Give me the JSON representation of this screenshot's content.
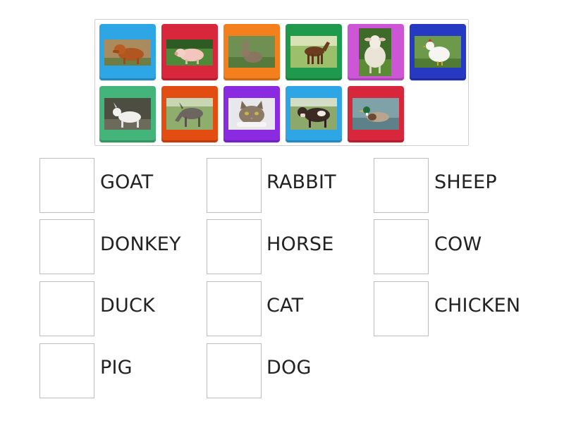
{
  "tiles": [
    {
      "icon": "dog-photo-icon",
      "color": "#2ea6e6"
    },
    {
      "icon": "pig-photo-icon",
      "color": "#d8263a"
    },
    {
      "icon": "rabbit-photo-icon",
      "color": "#f3801c"
    },
    {
      "icon": "horse-photo-icon",
      "color": "#1f9a4c"
    },
    {
      "icon": "sheep-photo-icon",
      "color": "#cc56d6"
    },
    {
      "icon": "chicken-photo-icon",
      "color": "#2539c2"
    },
    {
      "icon": "goat-photo-icon",
      "color": "#43b47a"
    },
    {
      "icon": "donkey-photo-icon",
      "color": "#e34d12"
    },
    {
      "icon": "cat-photo-icon",
      "color": "#8a2be2"
    },
    {
      "icon": "cow-photo-icon",
      "color": "#2ea6e6"
    },
    {
      "icon": "duck-photo-icon",
      "color": "#d8263a"
    }
  ],
  "targets": [
    {
      "label": "GOAT"
    },
    {
      "label": "RABBIT"
    },
    {
      "label": "SHEEP"
    },
    {
      "label": "DONKEY"
    },
    {
      "label": "HORSE"
    },
    {
      "label": "COW"
    },
    {
      "label": "DUCK"
    },
    {
      "label": "CAT"
    },
    {
      "label": "CHICKEN"
    },
    {
      "label": "PIG"
    },
    {
      "label": "DOG"
    }
  ]
}
